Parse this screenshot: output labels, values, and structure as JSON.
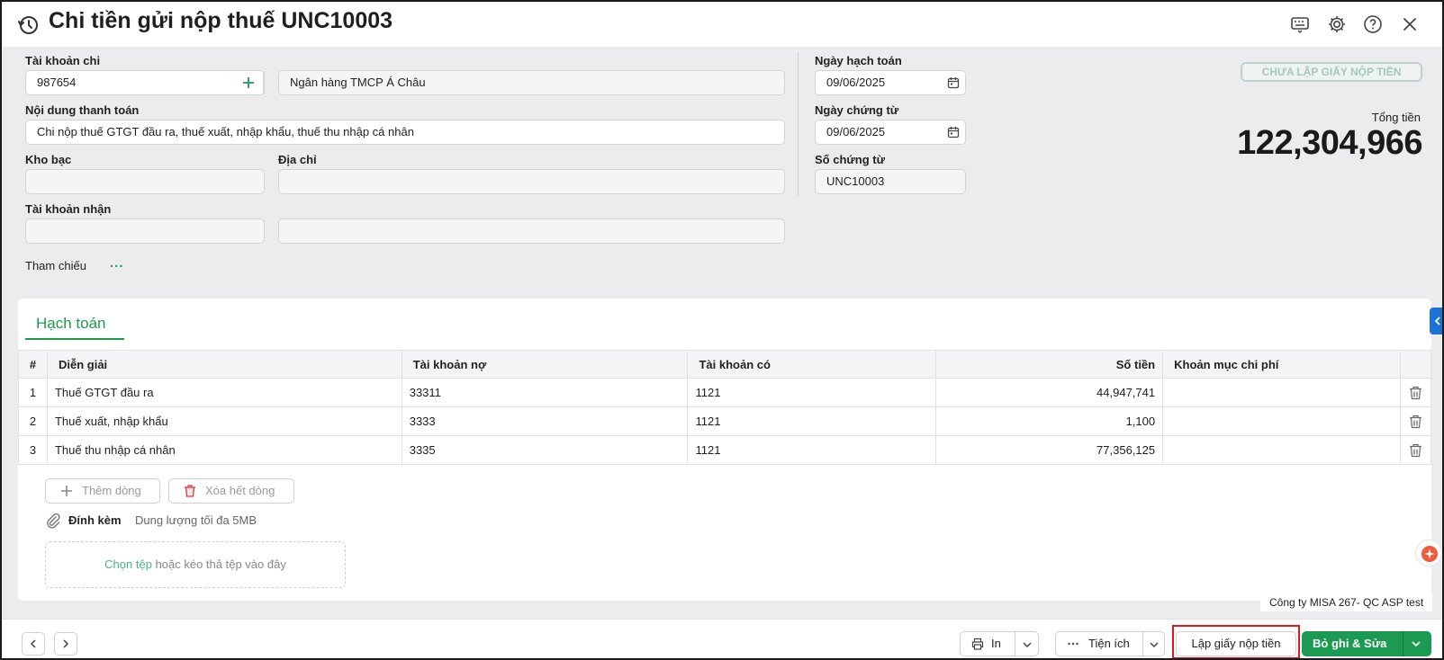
{
  "header": {
    "title": "Chi tiền gửi nộp thuế UNC10003"
  },
  "form": {
    "account_label": "Tài khoản chi",
    "account_value": "987654",
    "bank_value": "Ngân hàng TMCP Á Châu",
    "content_label": "Nội dung thanh toán",
    "content_value": "Chi nộp thuế GTGT đầu ra, thuế xuất, nhập khẩu, thuế thu nhập cá nhân",
    "treasury_label": "Kho bạc",
    "treasury_value": "",
    "address_label": "Địa chỉ",
    "address_value": "",
    "receive_account_label": "Tài khoản nhận",
    "receive_account_value": "",
    "receive_account_name": "",
    "posting_date_label": "Ngày hạch toán",
    "posting_date_value": "09/06/2025",
    "voucher_date_label": "Ngày chứng từ",
    "voucher_date_value": "09/06/2025",
    "voucher_no_label": "Số chứng từ",
    "voucher_no_value": "UNC10003",
    "reference_label": "Tham chiếu",
    "reference_more": "..."
  },
  "summary": {
    "status_badge": "CHƯA LẬP GIẤY NỘP TIỀN",
    "total_label": "Tổng tiền",
    "total_value": "122,304,966"
  },
  "panel": {
    "tab_label": "Hạch toán",
    "columns": [
      "#",
      "Diễn giải",
      "Tài khoản nợ",
      "Tài khoản có",
      "Số tiền",
      "Khoản mục chi phí"
    ],
    "rows": [
      {
        "no": "1",
        "desc": "Thuế GTGT đầu ra",
        "debit": "33311",
        "credit": "1121",
        "amount": "44,947,741",
        "cost_item": ""
      },
      {
        "no": "2",
        "desc": "Thuế xuất, nhập khẩu",
        "debit": "3333",
        "credit": "1121",
        "amount": "1,100",
        "cost_item": ""
      },
      {
        "no": "3",
        "desc": "Thuế thu nhập cá nhân",
        "debit": "3335",
        "credit": "1121",
        "amount": "77,356,125",
        "cost_item": ""
      }
    ],
    "add_row_label": "Thêm dòng",
    "delete_all_label": "Xóa hết dòng",
    "attach_label": "Đính kèm",
    "attach_hint": "Dung lượng tối đa 5MB",
    "dropzone_link": "Chọn tệp",
    "dropzone_text": " hoặc kéo thả tệp vào đây"
  },
  "company": "Công ty MISA 267- QC ASP test",
  "footer": {
    "print_label": "In",
    "utilities_label": "Tiện ích",
    "create_payment_label": "Lập giấy nộp tiền",
    "save_edit_label": "Bỏ ghi & Sửa"
  },
  "colors": {
    "accent": "#1d9a52",
    "highlight": "#e0191f",
    "side_tab": "#1e73d2"
  },
  "icons": [
    "history-icon",
    "keyboard-icon",
    "gear-icon",
    "help-icon",
    "close-icon",
    "plus-icon",
    "chevron-down-icon",
    "calendar-icon",
    "trash-icon",
    "paperclip-icon",
    "printer-icon",
    "more-icon",
    "chevron-left-icon",
    "chevron-right-icon"
  ]
}
